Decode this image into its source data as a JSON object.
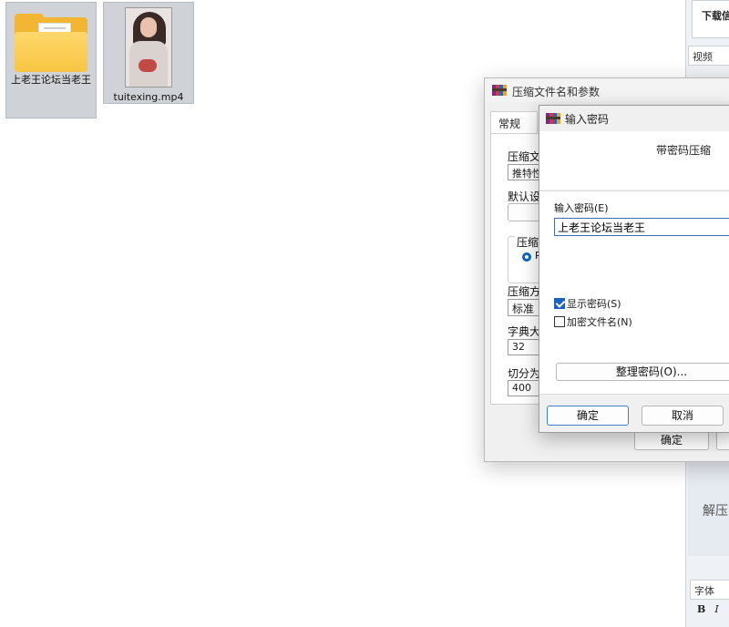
{
  "desktop": {
    "files": [
      {
        "name": "上老王论坛当老王",
        "icon": "folder-icon"
      },
      {
        "name": "tuitexing.mp4",
        "icon": "video-thumbnail"
      }
    ]
  },
  "background_app": {
    "download_header": "下载信",
    "video_field": "视频",
    "unzip_text": "解压",
    "font_field": "字体",
    "format_bold": "B",
    "format_italic": "I"
  },
  "archive_window": {
    "title": "压缩文件名和参数",
    "tab_general": "常规",
    "archive_name_label": "压缩文",
    "archive_name_value": "推特性",
    "default_profile_label": "默认设",
    "format_group_label": "压缩文",
    "format_radio_partial": "R",
    "method_label": "压缩方",
    "method_value": "标准",
    "dict_size_label": "字典大",
    "dict_size_value": "32",
    "split_label": "切分为",
    "split_value": "400",
    "ok_label": "确定"
  },
  "password_dialog": {
    "title": "输入密码",
    "banner_text": "带密码压缩",
    "password_label": "输入密码(E)",
    "password_value": "上老王论坛当老王",
    "show_password_label": "显示密码(S)",
    "show_password_checked": true,
    "encrypt_names_label": "加密文件名(N)",
    "encrypt_names_checked": false,
    "organize_button": "整理密码(O)...",
    "ok_label": "确定",
    "cancel_label": "取消"
  }
}
